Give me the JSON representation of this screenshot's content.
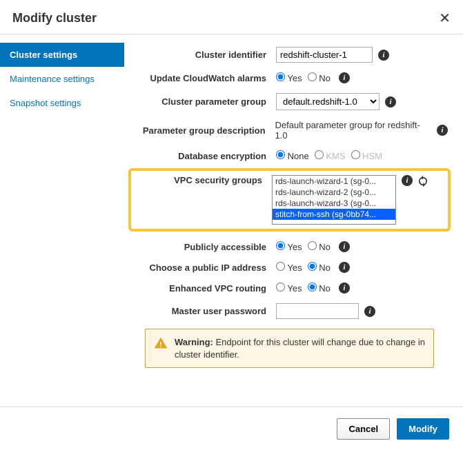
{
  "header": {
    "title": "Modify cluster"
  },
  "sidebar": {
    "items": [
      {
        "label": "Cluster settings",
        "name": "sidebar-cluster-settings",
        "active": true
      },
      {
        "label": "Maintenance settings",
        "name": "sidebar-maintenance-settings",
        "active": false
      },
      {
        "label": "Snapshot settings",
        "name": "sidebar-snapshot-settings",
        "active": false
      }
    ]
  },
  "fields": {
    "cluster_identifier": {
      "label": "Cluster identifier",
      "value": "redshift-cluster-1"
    },
    "update_cw_alarms": {
      "label": "Update CloudWatch alarms",
      "yes": "Yes",
      "no": "No"
    },
    "parameter_group": {
      "label": "Cluster parameter group",
      "value": "default.redshift-1.0"
    },
    "param_group_desc": {
      "label": "Parameter group description",
      "value": "Default parameter group for redshift-1.0"
    },
    "db_encryption": {
      "label": "Database encryption",
      "none": "None",
      "kms": "KMS",
      "hsm": "HSM"
    },
    "vpc_sg": {
      "label": "VPC security groups",
      "options": [
        {
          "text": "rds-launch-wizard-1 (sg-0...",
          "selected": false
        },
        {
          "text": "rds-launch-wizard-2 (sg-0...",
          "selected": false
        },
        {
          "text": "rds-launch-wizard-3 (sg-0...",
          "selected": false
        },
        {
          "text": "stitch-from-ssh (sg-0bb74...",
          "selected": true
        }
      ]
    },
    "publicly_accessible": {
      "label": "Publicly accessible",
      "yes": "Yes",
      "no": "No"
    },
    "public_ip": {
      "label": "Choose a public IP address",
      "yes": "Yes",
      "no": "No"
    },
    "enhanced_vpc": {
      "label": "Enhanced VPC routing",
      "yes": "Yes",
      "no": "No"
    },
    "master_password": {
      "label": "Master user password"
    }
  },
  "warning": {
    "label": "Warning: ",
    "text": "Endpoint for this cluster will change due to change in cluster identifier."
  },
  "footer": {
    "cancel": "Cancel",
    "modify": "Modify"
  }
}
